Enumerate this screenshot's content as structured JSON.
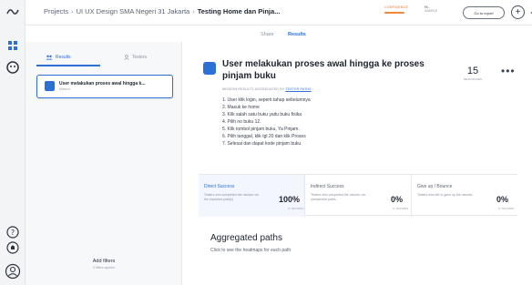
{
  "breadcrumb": {
    "items": [
      "Projects",
      "UI UX Design SMA Negeri 31 Jakarta",
      "Testing Home dan Pinja..."
    ]
  },
  "confidence": {
    "label": "CONFIDENCE",
    "level": "HI...",
    "sublabel": "SAMPLE",
    "color": "#f0883e"
  },
  "toolbar": {
    "report_label": "Go to report",
    "plus_icon": "plus-icon",
    "settings_icon": "gear-icon"
  },
  "subtabs": [
    {
      "label": "Share",
      "active": false
    },
    {
      "label": "Results",
      "active": true
    }
  ],
  "left_panel": {
    "tabs": [
      {
        "label": "Results",
        "icon": "people-icon",
        "active": true
      },
      {
        "label": "Testers",
        "icon": "person-icon",
        "active": false
      }
    ],
    "mission_card": {
      "title": "User melakukan proses awal hingga k...",
      "subtitle": "Mission"
    },
    "filters": {
      "label": "Add filters",
      "sub": "0 filters applied"
    }
  },
  "main": {
    "title": "User melakukan proses awal hingga ke proses pinjam buku",
    "meta_prefix": "MISSION RESULTS AGGREGATED BY",
    "meta_link": "TESTER PATHS",
    "meta_suffix": "↓",
    "steps": [
      "1. User klik login, seperti tahap sebelumnya",
      "2. Masuk ke home",
      "3. Klik salah satu buku yaitu buku fisika",
      "4. Pilih no buku 12.",
      "5. Klik tombol pinjam buku, Ya Pinjam.",
      "6. Pilih tanggal, klik tgl 20 dan klik Proses",
      "7. Selesai dan dapat kode pinjam buku"
    ],
    "responses": {
      "value": "15",
      "label": "RESPONSES"
    },
    "more_label": "•••"
  },
  "stats": [
    {
      "title": "Direct Success",
      "desc": "Testers who completed the mission via the expected path(s).",
      "percent": "100%",
      "unit": "% TESTERS",
      "color": "#2c6fd6"
    },
    {
      "title": "Indirect Success",
      "desc": "Testers who completed the mission via unexpected paths.",
      "percent": "0%",
      "unit": "% TESTERS",
      "color": "#5b6372"
    },
    {
      "title": "Give up / Bounce",
      "desc": "Testers who left or gave up the mission.",
      "percent": "0%",
      "unit": "% TESTERS",
      "color": "#5b6372"
    }
  ],
  "aggregated": {
    "title": "Aggregated paths",
    "subtitle": "Click to see the heatmaps for each path"
  },
  "rail": {
    "icons": [
      "logo-icon",
      "grid-icon",
      "face-icon",
      "help-icon",
      "bell-icon",
      "account-icon"
    ]
  }
}
